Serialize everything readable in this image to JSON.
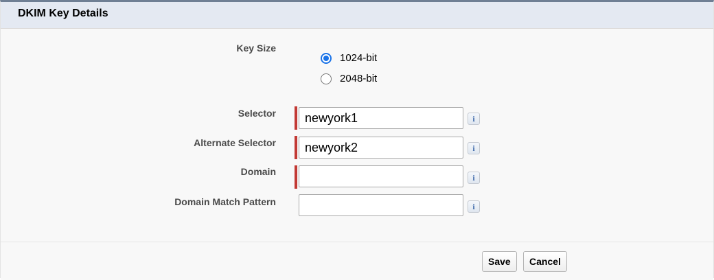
{
  "section": {
    "title": "DKIM Key Details"
  },
  "key_size": {
    "label": "Key Size",
    "options": [
      {
        "label": "1024-bit",
        "selected": true
      },
      {
        "label": "2048-bit",
        "selected": false
      }
    ]
  },
  "fields": {
    "selector": {
      "label": "Selector",
      "value": "newyork1",
      "required": true
    },
    "alternate_selector": {
      "label": "Alternate Selector",
      "value": "newyork2",
      "required": true
    },
    "domain": {
      "label": "Domain",
      "value": "",
      "required": true
    },
    "domain_match_pattern": {
      "label": "Domain Match Pattern",
      "value": "",
      "required": false
    }
  },
  "info_icon_glyph": "i",
  "buttons": {
    "save": "Save",
    "cancel": "Cancel"
  },
  "colors": {
    "required_bar": "#c23934",
    "radio_selected": "#1a73e8",
    "header_bg": "#e4e9f2"
  }
}
